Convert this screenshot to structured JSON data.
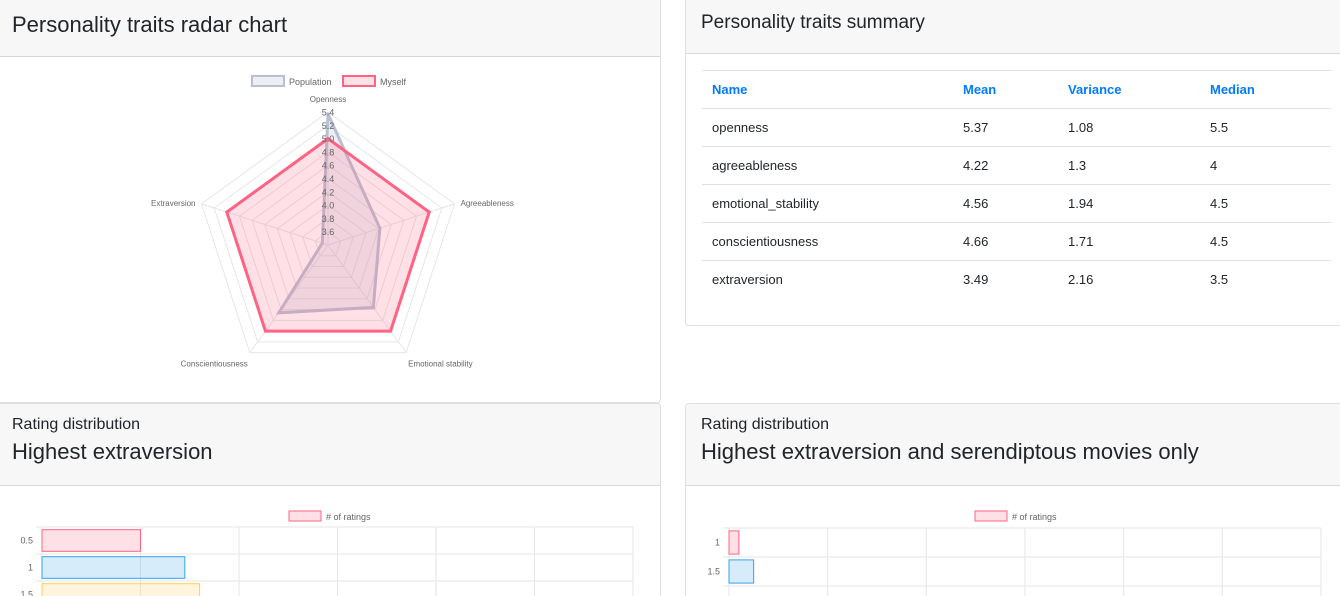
{
  "radar_card": {
    "title": "Personality traits radar chart"
  },
  "summary_card": {
    "title": "Personality traits summary",
    "columns": [
      "Name",
      "Mean",
      "Variance",
      "Median"
    ],
    "rows": [
      [
        "openness",
        "5.37",
        "1.08",
        "5.5"
      ],
      [
        "agreeableness",
        "4.22",
        "1.3",
        "4"
      ],
      [
        "emotional_stability",
        "4.56",
        "1.94",
        "4.5"
      ],
      [
        "conscientiousness",
        "4.66",
        "1.71",
        "4.5"
      ],
      [
        "extraversion",
        "3.49",
        "2.16",
        "3.5"
      ]
    ]
  },
  "dist_card_1": {
    "subtitle": "Rating distribution",
    "title": "Highest extraversion"
  },
  "dist_card_2": {
    "subtitle": "Rating distribution",
    "title": "Highest extraversion and serendiptous movies only"
  },
  "chart_data": [
    {
      "type": "radar",
      "labels": [
        "Openness",
        "Agreeableness",
        "Emotional stability",
        "Conscientiousness",
        "Extraversion"
      ],
      "r_ticks": [
        "3.6",
        "3.8",
        "4.0",
        "4.2",
        "4.4",
        "4.6",
        "4.8",
        "5.0",
        "5.2",
        "5.4"
      ],
      "r_min": 3.4,
      "r_max": 5.4,
      "series": [
        {
          "name": "Population",
          "values": [
            5.37,
            4.22,
            4.56,
            4.66,
            3.49
          ],
          "color": "#b9c0d2",
          "fill": "rgba(185,192,210,0.25)"
        },
        {
          "name": "Myself",
          "values": [
            5.0,
            5.0,
            5.0,
            5.0,
            5.0
          ],
          "color": "#ff6384",
          "fill": "rgba(255,99,132,0.2)"
        }
      ],
      "legend_position": "top"
    },
    {
      "type": "bar",
      "orientation": "horizontal",
      "series_name": "# of ratings",
      "categories": [
        "0.5",
        "1",
        "1.5"
      ],
      "values": [
        1,
        1.45,
        1.6
      ],
      "xlim": [
        0,
        6
      ],
      "colors": [
        "#ff6384",
        "#36a2eb",
        "#ffce56"
      ]
    },
    {
      "type": "bar",
      "orientation": "horizontal",
      "series_name": "# of ratings",
      "categories": [
        "1",
        "1.5"
      ],
      "values": [
        0.1,
        0.25
      ],
      "xlim": [
        0,
        6
      ],
      "colors": [
        "#ff6384",
        "#36a2eb",
        "#ffce56"
      ]
    }
  ]
}
